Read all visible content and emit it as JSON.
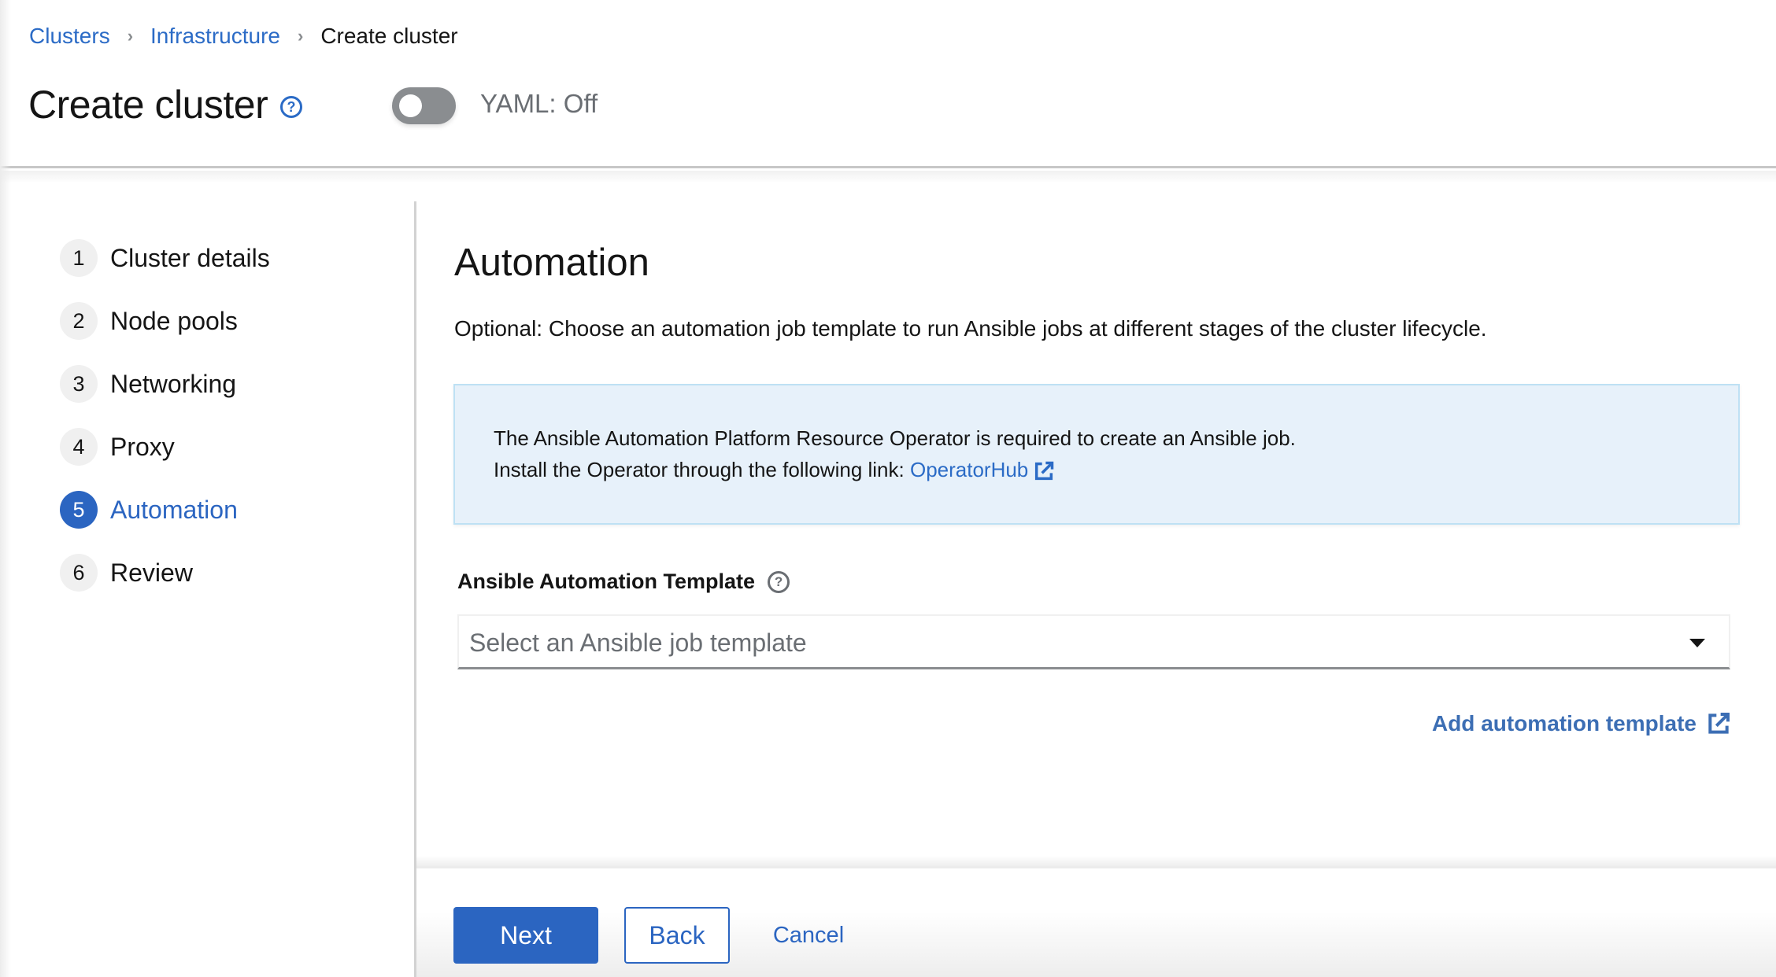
{
  "breadcrumb": {
    "items": [
      {
        "label": "Clusters",
        "link": true
      },
      {
        "label": "Infrastructure",
        "link": true
      },
      {
        "label": "Create cluster",
        "link": false
      }
    ]
  },
  "header": {
    "title": "Create cluster",
    "help_icon": "question-circle-icon",
    "yaml_toggle": {
      "label": "YAML: Off",
      "on": false
    }
  },
  "wizard": {
    "steps": [
      {
        "number": "1",
        "label": "Cluster details",
        "active": false
      },
      {
        "number": "2",
        "label": "Node pools",
        "active": false
      },
      {
        "number": "3",
        "label": "Networking",
        "active": false
      },
      {
        "number": "4",
        "label": "Proxy",
        "active": false
      },
      {
        "number": "5",
        "label": "Automation",
        "active": true
      },
      {
        "number": "6",
        "label": "Review",
        "active": false
      }
    ]
  },
  "main": {
    "title": "Automation",
    "description": "Optional: Choose an automation job template to run Ansible jobs at different stages of the cluster lifecycle.",
    "alert": {
      "line1": "The Ansible Automation Platform Resource Operator is required to create an Ansible job.",
      "line2_prefix": "Install the Operator through the following link: ",
      "link_label": "OperatorHub",
      "link_icon": "external-link-icon"
    },
    "template_field": {
      "label": "Ansible Automation Template",
      "help_icon": "question-circle-icon",
      "placeholder": "Select an Ansible job template",
      "value": ""
    },
    "add_template_link": {
      "label": "Add automation template",
      "icon": "external-link-icon"
    }
  },
  "footer": {
    "next_label": "Next",
    "back_label": "Back",
    "cancel_label": "Cancel"
  },
  "colors": {
    "primary": "#2b65c1",
    "link": "#2b6bc6",
    "alert_bg": "#e7f1fa",
    "alert_border": "#bee1f4",
    "toggle_off": "#8a8d90"
  }
}
